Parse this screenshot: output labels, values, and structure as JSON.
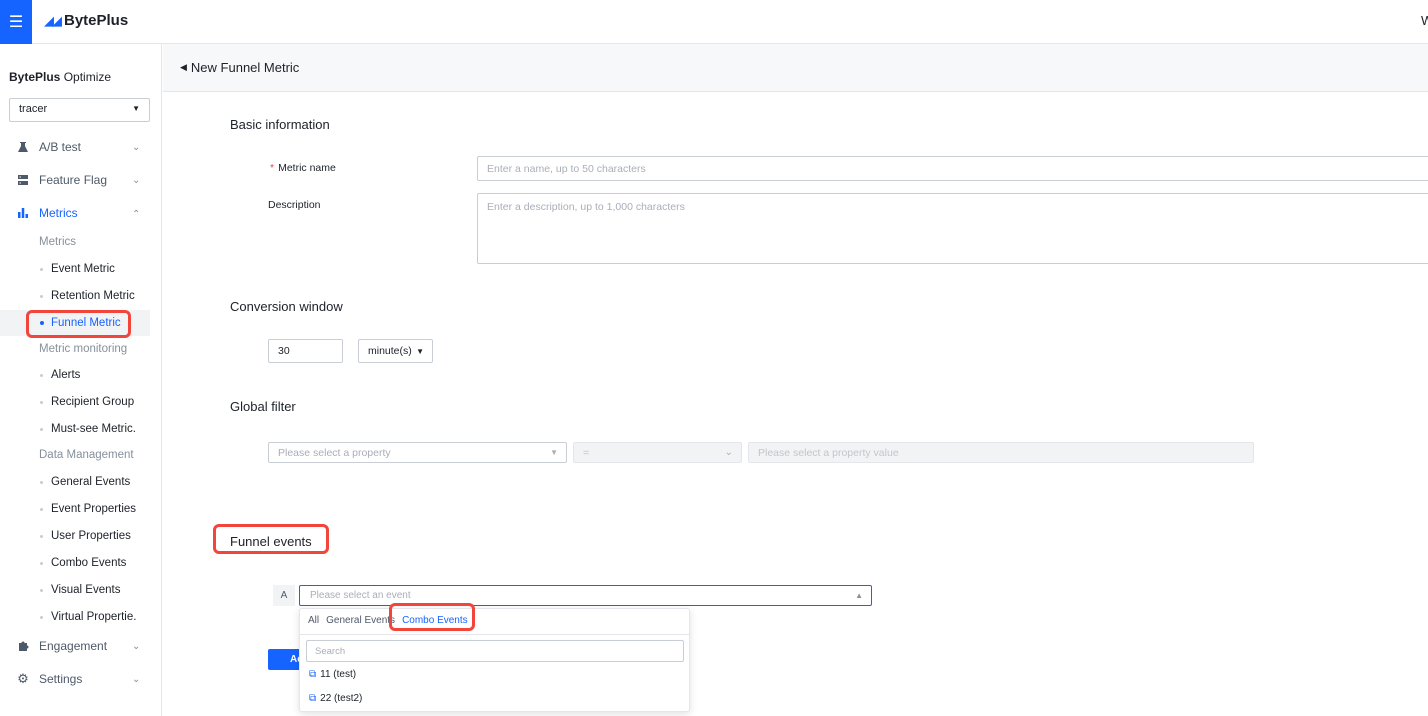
{
  "topbar": {
    "brand": "BytePlus",
    "right_text": "W"
  },
  "sidebar": {
    "product_bold": "BytePlus",
    "product_rest": " Optimize",
    "app": "tracer",
    "nav": {
      "abtest": "A/B test",
      "featureflag": "Feature Flag",
      "metrics": "Metrics",
      "engagement": "Engagement",
      "settings": "Settings"
    },
    "groups": {
      "metrics": "Metrics",
      "monitoring": "Metric monitoring",
      "data": "Data Management"
    },
    "subs": {
      "event_metric": "Event Metric",
      "retention_metric": "Retention Metric",
      "funnel_metric": "Funnel Metric",
      "alerts": "Alerts",
      "recipient_group": "Recipient Group",
      "must_see": "Must-see Metric.",
      "general_events": "General Events",
      "event_properties": "Event Properties",
      "user_properties": "User Properties",
      "combo_events": "Combo Events",
      "visual_events": "Visual Events",
      "virtual_properties": "Virtual Propertie."
    }
  },
  "header": {
    "title": "New Funnel Metric"
  },
  "form": {
    "basic_title": "Basic information",
    "metric_name_label": "Metric name",
    "metric_name_placeholder": "Enter a name, up to 50 characters",
    "description_label": "Description",
    "description_placeholder": "Enter a description, up to 1,000 characters",
    "conversion_title": "Conversion window",
    "window_value": "30",
    "window_unit": "minute(s)",
    "global_filter_title": "Global filter",
    "property_placeholder": "Please select a property",
    "operator": "=",
    "property_value_placeholder": "Please select a property value",
    "funnel_title": "Funnel events",
    "step_label": "A",
    "event_placeholder": "Please select an event",
    "add_button": "Add"
  },
  "dropdown": {
    "tabs": [
      "All",
      "General Events",
      "Combo Events"
    ],
    "search_placeholder": "Search",
    "items": [
      "11 (test)",
      "22 (test2)"
    ]
  },
  "colors": {
    "accent": "#1664ff",
    "highlight": "#f2463c"
  }
}
